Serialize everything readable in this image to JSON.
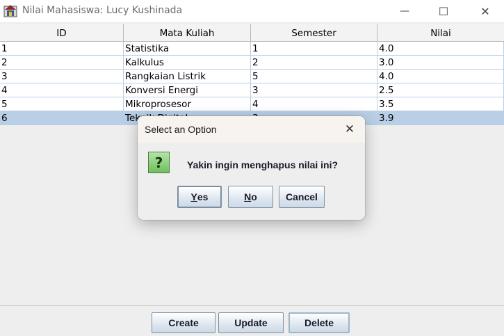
{
  "window": {
    "title": "Nilai Mahasiswa: Lucy Kushinada",
    "minimize": "—",
    "maximize": "☐",
    "close": "✕"
  },
  "table": {
    "columns": [
      "ID",
      "Mata Kuliah",
      "Semester",
      "Nilai"
    ],
    "rows": [
      {
        "id": "1",
        "course": "Statistika",
        "semester": "1",
        "grade": "4.0"
      },
      {
        "id": "2",
        "course": "Kalkulus",
        "semester": "2",
        "grade": "3.0"
      },
      {
        "id": "3",
        "course": "Rangkaian Listrik",
        "semester": "5",
        "grade": "4.0"
      },
      {
        "id": "4",
        "course": "Konversi Energi",
        "semester": "3",
        "grade": "2.5"
      },
      {
        "id": "5",
        "course": "Mikroprosesor",
        "semester": "4",
        "grade": "3.5"
      },
      {
        "id": "6",
        "course": "Teknik Digital",
        "semester": "3",
        "grade": "3.9",
        "selected": true
      }
    ]
  },
  "buttons": {
    "create": "Create",
    "update": "Update",
    "delete": "Delete"
  },
  "dialog": {
    "title": "Select an Option",
    "close": "✕",
    "icon": "?",
    "message": "Yakin ingin menghapus nilai ini?",
    "yes_mnemonic": "Y",
    "yes_rest": "es",
    "no_mnemonic": "N",
    "no_rest": "o",
    "cancel": "Cancel"
  }
}
